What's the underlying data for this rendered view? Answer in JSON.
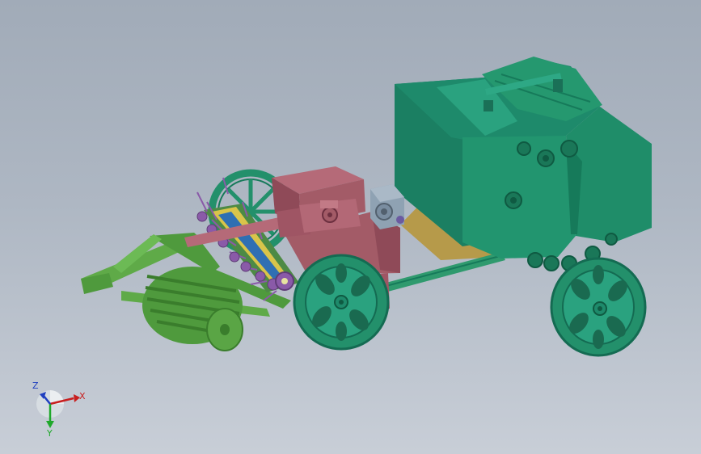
{
  "viewport": {
    "background_top": "#a1abb8",
    "background_bottom": "#c8ced7"
  },
  "model": {
    "colors": {
      "baler_body": "#1e8a6b",
      "baler_body_dark": "#146b52",
      "baler_body_light": "#2aa27f",
      "hitch_frame": "#4f9a3d",
      "hitch_frame_light": "#6cba55",
      "feeder_housing": "#a35b67",
      "feeder_housing_dark": "#7f3d4b",
      "wheel": "#23906b",
      "pickup_tines": "#8a5aa8",
      "chute_floor": "#b69a4a",
      "gearbox": "#8fa2b3"
    },
    "parts": [
      "hitch-frame",
      "front-roller",
      "pickup-reel",
      "feeder-housing",
      "gearbox",
      "bale-chamber",
      "left-wheel",
      "right-wheel",
      "cutter-wheel"
    ]
  },
  "triad": {
    "x_label": "X",
    "y_label": "Y",
    "z_label": "Z",
    "x_color": "#c81e1e",
    "y_color": "#1fa82b",
    "z_color": "#1f3fbf",
    "icon": "coordinate-triad-icon"
  }
}
